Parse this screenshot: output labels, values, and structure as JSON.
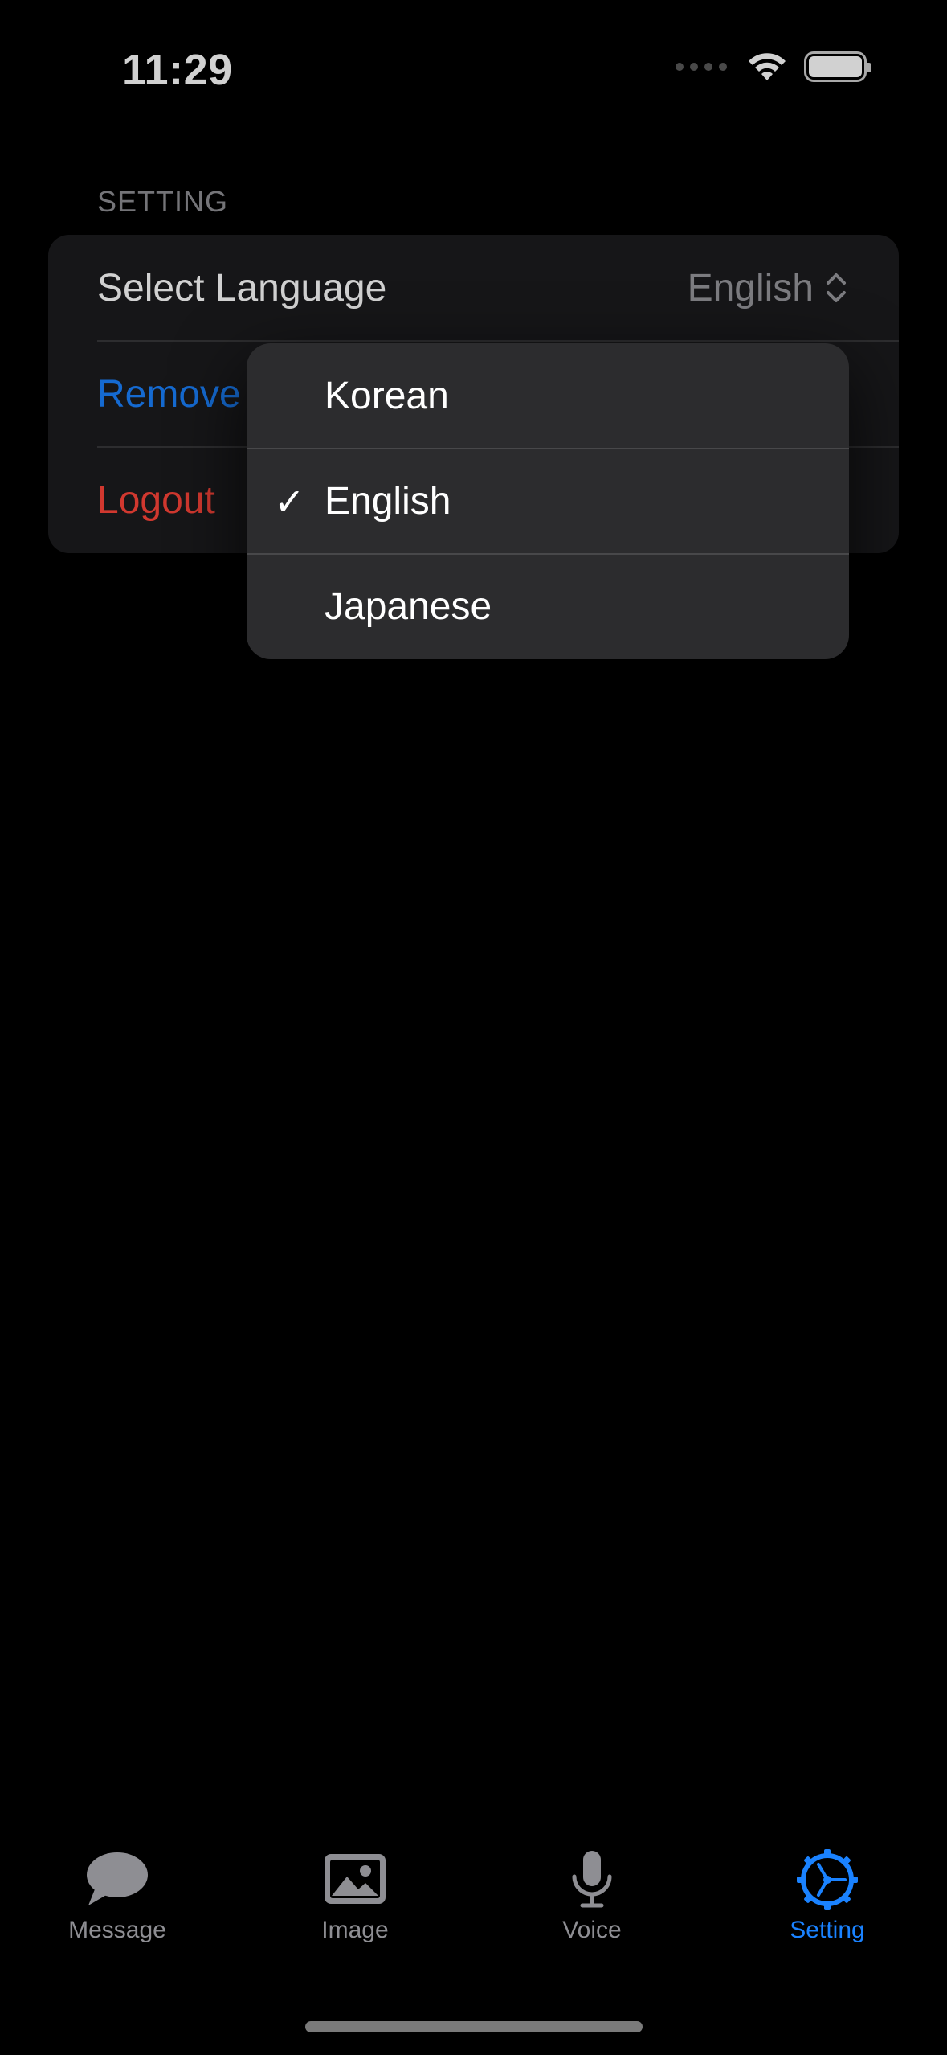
{
  "status_bar": {
    "time": "11:29"
  },
  "settings": {
    "section_header": "SETTING",
    "select_language_label": "Select Language",
    "selected_language": "English",
    "remove_label": "Remove",
    "logout_label": "Logout"
  },
  "language_menu": {
    "options": [
      "Korean",
      "English",
      "Japanese"
    ],
    "selected_index": 1,
    "checkmark": "✓"
  },
  "tabbar": {
    "tabs": [
      {
        "label": "Message",
        "icon": "message-bubble-icon"
      },
      {
        "label": "Image",
        "icon": "photo-icon"
      },
      {
        "label": "Voice",
        "icon": "microphone-icon"
      },
      {
        "label": "Setting",
        "icon": "gear-icon",
        "active": true
      }
    ]
  },
  "colors": {
    "accent": "#1a82ff",
    "destructive": "#ff453a",
    "background": "#000000",
    "card": "#1c1c1e",
    "menu": "#2c2c2e"
  }
}
